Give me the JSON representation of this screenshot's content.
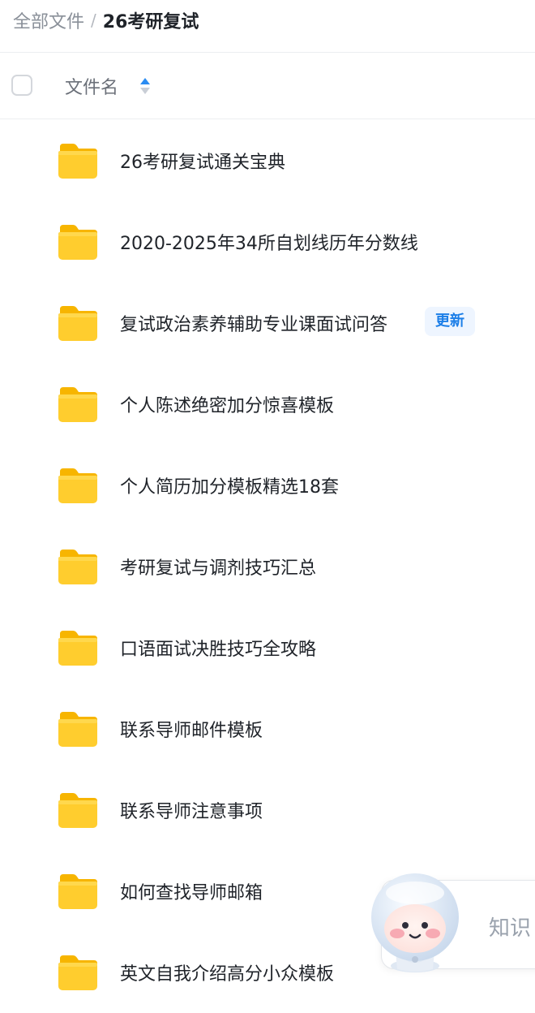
{
  "breadcrumb": {
    "root": "全部文件",
    "separator": "/",
    "current": "26考研复试"
  },
  "list_header": {
    "column_name": "文件名",
    "sort_icon": "sort-toggle-icon"
  },
  "files": [
    {
      "name": "26考研复试通关宝典",
      "icon": "folder-icon"
    },
    {
      "name": "2020-2025年34所自划线历年分数线",
      "icon": "folder-icon"
    },
    {
      "name": "复试政治素养辅助专业课面试问答",
      "icon": "folder-icon",
      "badge": "更新"
    },
    {
      "name": "个人陈述绝密加分惊喜模板",
      "icon": "folder-icon"
    },
    {
      "name": "个人简历加分模板精选18套",
      "icon": "folder-icon"
    },
    {
      "name": "考研复试与调剂技巧汇总",
      "icon": "folder-icon"
    },
    {
      "name": "口语面试决胜技巧全攻略",
      "icon": "folder-icon"
    },
    {
      "name": "联系导师邮件模板",
      "icon": "folder-icon"
    },
    {
      "name": "联系导师注意事项",
      "icon": "folder-icon"
    },
    {
      "name": "如何查找导师邮箱",
      "icon": "folder-icon"
    },
    {
      "name": "英文自我介绍高分小众模板",
      "icon": "folder-icon"
    }
  ],
  "assistant": {
    "label": "知识",
    "icon": "mascot-avatar-icon"
  },
  "colors": {
    "folder": "#ffcd2e",
    "badge_text": "#1d7fe8",
    "badge_bg": "#eef5ff",
    "sort_up": "#2b8cf2",
    "sort_down": "#c9ced6"
  }
}
